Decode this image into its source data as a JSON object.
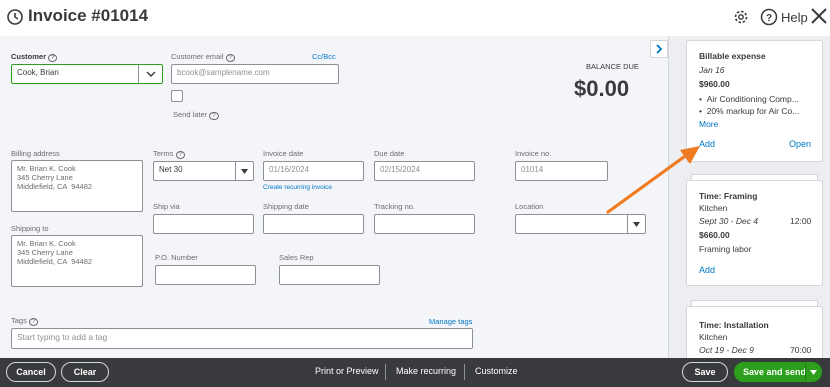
{
  "header": {
    "title": "Invoice #01014",
    "help_label": "Help"
  },
  "form": {
    "customer": {
      "label": "Customer",
      "value": "Cook, Brian"
    },
    "customer_email": {
      "label": "Customer email",
      "placeholder": "bcook@samplename.com",
      "cc_bcc": "Cc/Bcc"
    },
    "send_later": "Send later",
    "balance_due": {
      "label": "BALANCE DUE",
      "value": "$0.00"
    },
    "billing_address": {
      "label": "Billing address",
      "value": "Mr. Brian K. Cook\n345 Cherry Lane\nMiddlefield, CA  94482"
    },
    "terms": {
      "label": "Terms",
      "value": "Net 30"
    },
    "invoice_date": {
      "label": "Invoice date",
      "value": "01/16/2024"
    },
    "due_date": {
      "label": "Due date",
      "value": "02/15/2024"
    },
    "invoice_no": {
      "label": "Invoice no.",
      "value": "01014"
    },
    "create_recurring": "Create recurring invoice",
    "ship_via": "Ship via",
    "shipping_date": "Shipping date",
    "tracking_no": "Tracking no.",
    "location": "Location",
    "shipping_to": {
      "label": "Shipping to",
      "value": "Mr. Brian K. Cook\n345 Cherry Lane\nMiddlefield, CA  94482"
    },
    "po_number": "P.O. Number",
    "sales_rep": "Sales Rep",
    "tags": {
      "label": "Tags",
      "placeholder": "Start typing to add a tag",
      "manage": "Manage tags"
    }
  },
  "panel": {
    "cards": [
      {
        "title": "Billable expense",
        "date": "Jan 16",
        "amount": "$960.00",
        "bullets": [
          "Air Conditioning Comp...",
          "20% markup for Air Co..."
        ],
        "more": "More",
        "add": "Add",
        "open": "Open"
      },
      {
        "title": "Time: Framing",
        "subtitle": "Kitchen",
        "date": "Sept 30 - Dec 4",
        "hours": "12:00",
        "amount": "$660.00",
        "desc": "Framing labor",
        "add": "Add"
      },
      {
        "title": "Time: Installation",
        "subtitle": "Kitchen",
        "date": "Oct 19 - Dec 9",
        "hours": "70:00"
      }
    ]
  },
  "footer": {
    "cancel": "Cancel",
    "clear": "Clear",
    "print_preview": "Print or Preview",
    "make_recurring": "Make recurring",
    "customize": "Customize",
    "save": "Save",
    "save_and_send": "Save and send"
  },
  "colors": {
    "accent_green": "#2ca01c",
    "link_blue": "#0077c5",
    "arrow_orange": "#f07b20",
    "footer_bg": "#393a3d"
  }
}
